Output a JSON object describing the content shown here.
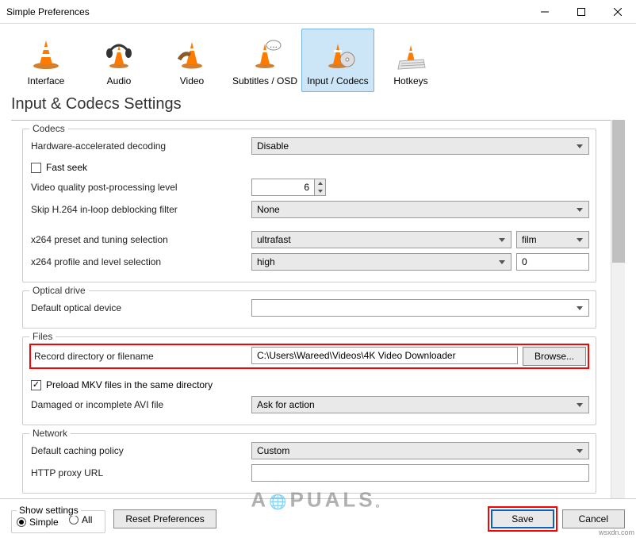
{
  "window": {
    "title": "Simple Preferences"
  },
  "tabs": {
    "interface": "Interface",
    "audio": "Audio",
    "video": "Video",
    "subtitles": "Subtitles / OSD",
    "input": "Input / Codecs",
    "hotkeys": "Hotkeys"
  },
  "page": {
    "title": "Input & Codecs Settings"
  },
  "codecs": {
    "legend": "Codecs",
    "hw_label": "Hardware-accelerated decoding",
    "hw_value": "Disable",
    "fastseek_label": "Fast seek",
    "quality_label": "Video quality post-processing level",
    "quality_value": "6",
    "skip_label": "Skip H.264 in-loop deblocking filter",
    "skip_value": "None",
    "x264_preset_label": "x264 preset and tuning selection",
    "x264_preset_value": "ultrafast",
    "x264_tuning_value": "film",
    "x264_profile_label": "x264 profile and level selection",
    "x264_profile_value": "high",
    "x264_level_value": "0"
  },
  "optical": {
    "legend": "Optical drive",
    "default_label": "Default optical device",
    "default_value": ""
  },
  "files": {
    "legend": "Files",
    "record_label": "Record directory or filename",
    "record_value": "C:\\Users\\Wareed\\Videos\\4K Video Downloader",
    "browse": "Browse...",
    "preload_label": "Preload MKV files in the same directory",
    "avi_label": "Damaged or incomplete AVI file",
    "avi_value": "Ask for action"
  },
  "network": {
    "legend": "Network",
    "caching_label": "Default caching policy",
    "caching_value": "Custom",
    "proxy_label": "HTTP proxy URL",
    "proxy_value": ""
  },
  "bottom": {
    "show_settings": "Show settings",
    "simple": "Simple",
    "all": "All",
    "reset": "Reset Preferences",
    "save": "Save",
    "cancel": "Cancel"
  },
  "meta": {
    "corner": "wsxdn.com"
  }
}
